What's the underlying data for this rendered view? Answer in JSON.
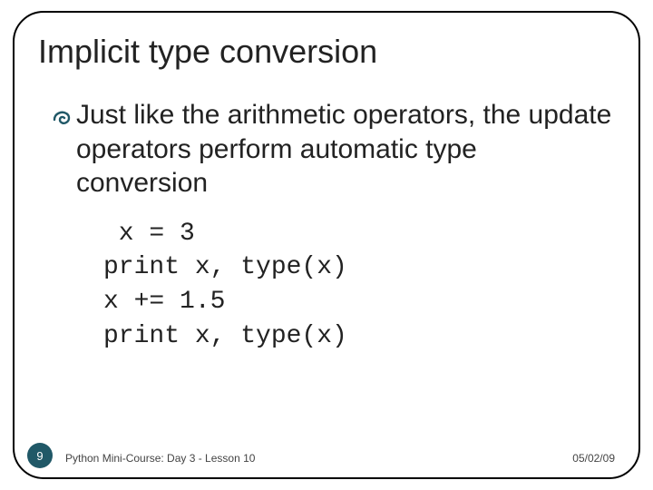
{
  "slide": {
    "title": "Implicit type conversion",
    "bullet": "Just like the arithmetic operators, the update operators perform automatic type conversion",
    "code": {
      "line1": " x = 3",
      "line2": "print x, type(x)",
      "line3": "x += 1.5",
      "line4": "print x, type(x)"
    },
    "page_number": "9",
    "footer_left": "Python Mini-Course: Day 3 - Lesson 10",
    "footer_right": "05/02/09"
  }
}
